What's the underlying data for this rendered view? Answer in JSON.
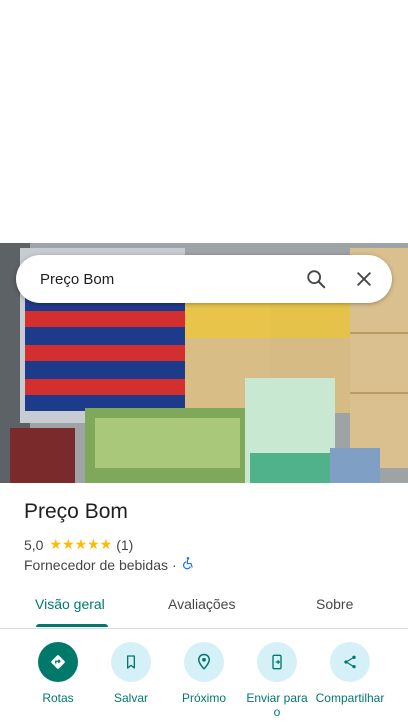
{
  "search": {
    "query": "Preço Bom"
  },
  "place": {
    "name": "Preço Bom",
    "rating": "5,0",
    "stars": "★★★★★",
    "review_count": "(1)",
    "category": "Fornecedor de bebidas",
    "separator": "·"
  },
  "tabs": [
    {
      "label": "Visão geral",
      "active": true
    },
    {
      "label": "Avaliações",
      "active": false
    },
    {
      "label": "Sobre",
      "active": false
    }
  ],
  "actions": [
    {
      "label": "Rotas",
      "icon": "directions-icon"
    },
    {
      "label": "Salvar",
      "icon": "bookmark-icon"
    },
    {
      "label": "Próximo",
      "icon": "nearby-icon"
    },
    {
      "label": "Enviar para o",
      "icon": "send-to-phone-icon"
    },
    {
      "label": "Compartilhar",
      "icon": "share-icon"
    }
  ],
  "colors": {
    "accent": "#00796b",
    "star": "#fbbc04",
    "action_bg": "#d6f0f7"
  },
  "photo": {
    "subject": "product-photo"
  }
}
